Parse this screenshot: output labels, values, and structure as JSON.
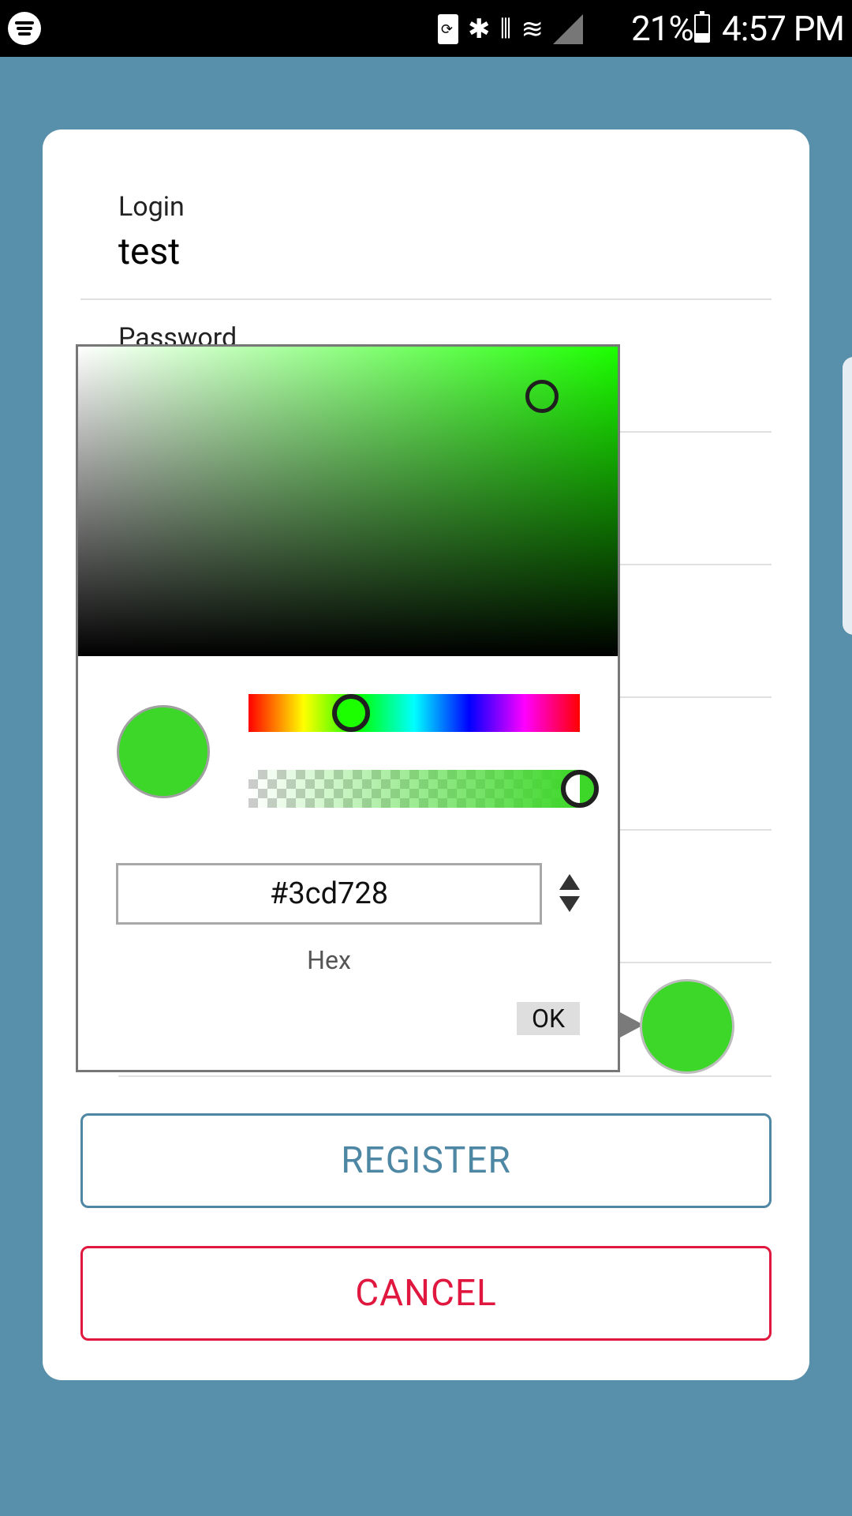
{
  "status_bar": {
    "battery_percent": "21%",
    "time": "4:57 PM",
    "icons": [
      "spotify-icon",
      "battery-saver-icon",
      "bluetooth-icon",
      "vibrate-icon",
      "wifi-icon",
      "signal-icon",
      "battery-icon"
    ]
  },
  "form": {
    "login": {
      "label": "Login",
      "value": "test"
    },
    "password": {
      "label": "Password"
    }
  },
  "buttons": {
    "register": "REGISTER",
    "cancel": "CANCEL"
  },
  "color_picker": {
    "hex_value": "#3cd728",
    "mode_label": "Hex",
    "ok_label": "OK",
    "hue_color": "#1cff00",
    "selected_color": "#3cd728",
    "saturation": 0.86,
    "brightness": 0.84,
    "hue_position": 0.31,
    "alpha": 1.0
  },
  "colors": {
    "background": "#588fab",
    "register_accent": "#4e87a3",
    "cancel_accent": "#e0173e"
  }
}
